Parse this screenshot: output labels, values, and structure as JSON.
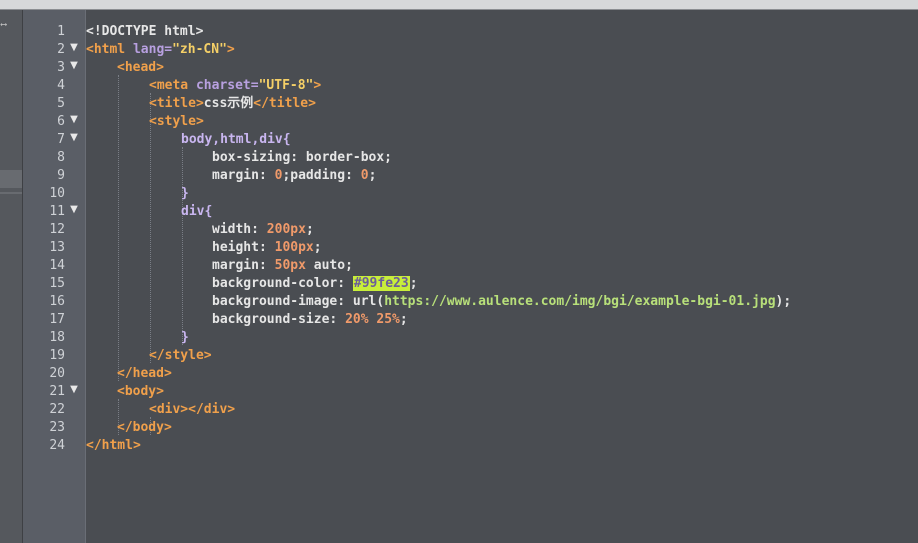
{
  "gutter": {
    "lines": [
      "1",
      "2",
      "3",
      "4",
      "5",
      "6",
      "7",
      "8",
      "9",
      "10",
      "11",
      "12",
      "13",
      "14",
      "15",
      "16",
      "17",
      "18",
      "19",
      "20",
      "21",
      "22",
      "23",
      "24"
    ],
    "fold_marker": "▼"
  },
  "code": {
    "l1": "<!DOCTYPE html>",
    "l2_open": "<html",
    "l2_attr": " lang=",
    "l2_val": "\"zh-CN\"",
    "l2_close": ">",
    "l3": "<head>",
    "l4_open": "<meta",
    "l4_attr": " charset=",
    "l4_val": "\"UTF-8\"",
    "l4_close": ">",
    "l5_open": "<title>",
    "l5_text": "css示例",
    "l5_close": "</title>",
    "l6": "<style>",
    "l7_sel": "body,html,div{",
    "l8_prop": "box-sizing: border-box;",
    "l9_prop": "margin: ",
    "l9_num1": "0",
    "l9_mid": ";padding: ",
    "l9_num2": "0",
    "l9_end": ";",
    "l10": "}",
    "l11": "div{",
    "l12_prop": "width: ",
    "l12_num": "200px",
    "l12_end": ";",
    "l13_prop": "height: ",
    "l13_num": "100px",
    "l13_end": ";",
    "l14_prop": "margin: ",
    "l14_num": "50px",
    "l14_rest": " auto;",
    "l15_prop": "background-color: ",
    "l15_hex": "#99fe23",
    "l15_end": ";",
    "l16_prop": "background-image: url(",
    "l16_url": "https://www.aulence.com/img/bgi/example-bgi-01.jpg",
    "l16_end": ");",
    "l17_prop": "background-size: ",
    "l17_num1": "20%",
    "l17_sp": " ",
    "l17_num2": "25%",
    "l17_end": ";",
    "l18": "}",
    "l19": "</style>",
    "l20": "</head>",
    "l21": "<body>",
    "l22": "<div></div>",
    "l23": "</body>",
    "l24": "</html>"
  },
  "colors": {
    "background": "#4a4d52",
    "gutter": "#5a5e66",
    "tag": "#f0a04b",
    "string": "#f5d067",
    "number": "#f09a6a",
    "url": "#b8e07a",
    "hex_highlight": "#c8ee3a"
  }
}
